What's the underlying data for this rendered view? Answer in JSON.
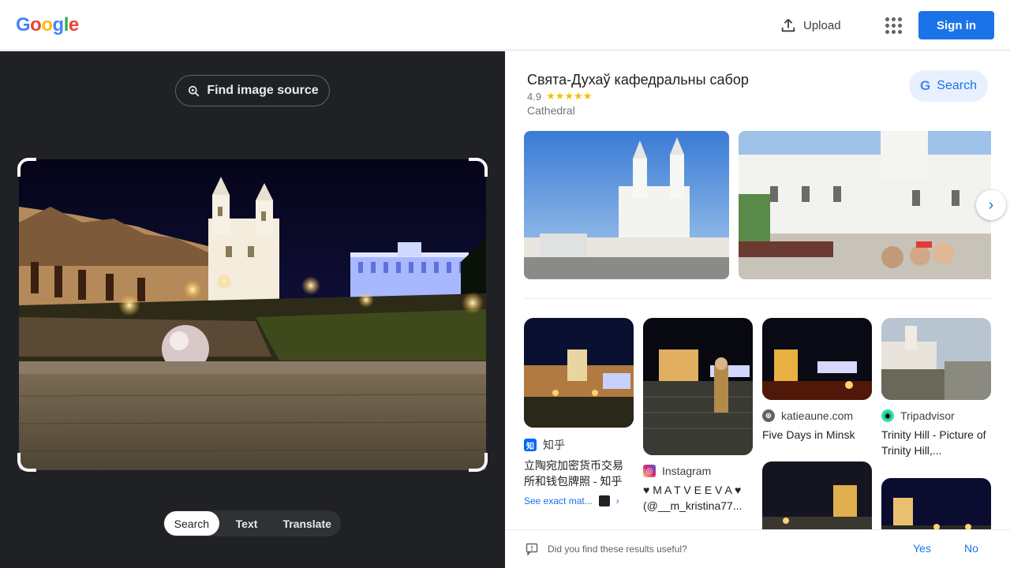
{
  "header": {
    "logo_letters": [
      {
        "ch": "G",
        "color": "#4285f4"
      },
      {
        "ch": "o",
        "color": "#ea4335"
      },
      {
        "ch": "o",
        "color": "#fbbc05"
      },
      {
        "ch": "g",
        "color": "#4285f4"
      },
      {
        "ch": "l",
        "color": "#34a853"
      },
      {
        "ch": "e",
        "color": "#ea4335"
      }
    ],
    "upload_label": "Upload",
    "signin_label": "Sign in"
  },
  "left": {
    "find_source_label": "Find image source",
    "tabs": [
      "Search",
      "Text",
      "Translate"
    ],
    "active_tab": "Search"
  },
  "knowledge_panel": {
    "title": "Свята-Духаў кафедральны сабор",
    "rating": "4.9",
    "stars": "★★★★★",
    "type": "Cathedral",
    "search_label": "Search"
  },
  "results": [
    {
      "source": "知乎",
      "favicon": "知",
      "favicon_color": "#0066ff",
      "title": "立陶宛加密货币交易所和钱包牌照 - 知乎",
      "see_exact": "See exact mat..."
    },
    {
      "source": "Instagram",
      "favicon": "◎",
      "favicon_color": "#d6249f",
      "title": "♥ M A T V E E V A ♥ (@__m_kristina77..."
    },
    {
      "source": "katieaune.com",
      "favicon": "⊕",
      "favicon_color": "#5f6368",
      "title": "Five Days in Minsk"
    },
    {
      "source": "Tripadvisor",
      "favicon": "◉",
      "favicon_color": "#34e0a1",
      "title": "Trinity Hill - Picture of Trinity Hill,..."
    }
  ],
  "feedback": {
    "question": "Did you find these results useful?",
    "yes": "Yes",
    "no": "No"
  },
  "colors": {
    "accent": "#1a73e8",
    "dark_panel": "#202124"
  }
}
